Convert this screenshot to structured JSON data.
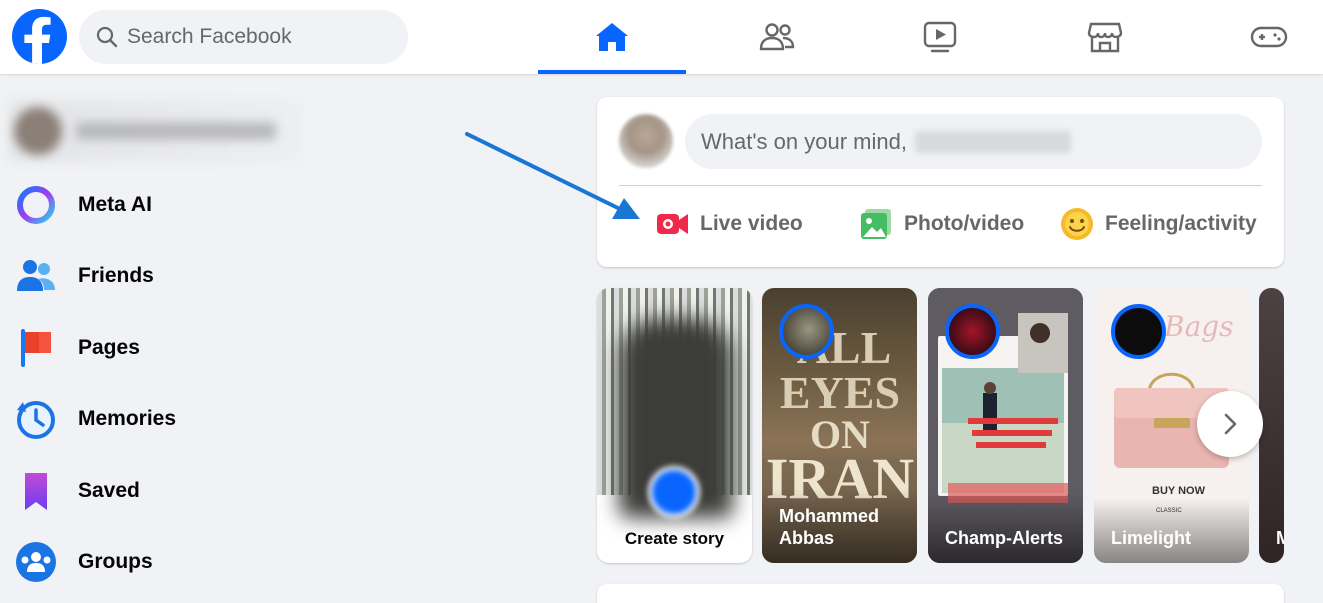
{
  "topbar": {
    "logo_icon": "facebook-logo",
    "search": {
      "placeholder": "Search Facebook",
      "value": ""
    },
    "nav_tabs": [
      {
        "name": "home",
        "icon": "home-icon",
        "active": true
      },
      {
        "name": "friends",
        "icon": "friends-icon",
        "active": false
      },
      {
        "name": "video",
        "icon": "video-icon",
        "active": false
      },
      {
        "name": "marketplace",
        "icon": "marketplace-icon",
        "active": false
      },
      {
        "name": "gaming",
        "icon": "gaming-icon",
        "active": false
      }
    ]
  },
  "sidebar": {
    "items": [
      {
        "label": "Meta AI",
        "icon": "meta-ai-icon"
      },
      {
        "label": "Friends",
        "icon": "friends-icon"
      },
      {
        "label": "Pages",
        "icon": "pages-flag-icon"
      },
      {
        "label": "Memories",
        "icon": "memories-clock-icon"
      },
      {
        "label": "Saved",
        "icon": "saved-bookmark-icon"
      },
      {
        "label": "Groups",
        "icon": "groups-icon"
      }
    ]
  },
  "composer": {
    "prompt": "What's on your mind,",
    "actions": [
      {
        "label": "Live video",
        "icon": "live-video-icon"
      },
      {
        "label": "Photo/video",
        "icon": "photo-video-icon"
      },
      {
        "label": "Feeling/activity",
        "icon": "feeling-icon"
      }
    ]
  },
  "stories": [
    {
      "name": "Create story"
    },
    {
      "name": "Mohammed Abbas",
      "overlay_text": "ALL EYES ON IRAN"
    },
    {
      "name": "Champ-Alerts"
    },
    {
      "name": "Limelight",
      "overlay_text": "BUY NOW"
    },
    {
      "name": "M"
    }
  ],
  "colors": {
    "brand": "#0866ff",
    "background": "#f0f2f5",
    "annotation_arrow": "#1877d2"
  }
}
